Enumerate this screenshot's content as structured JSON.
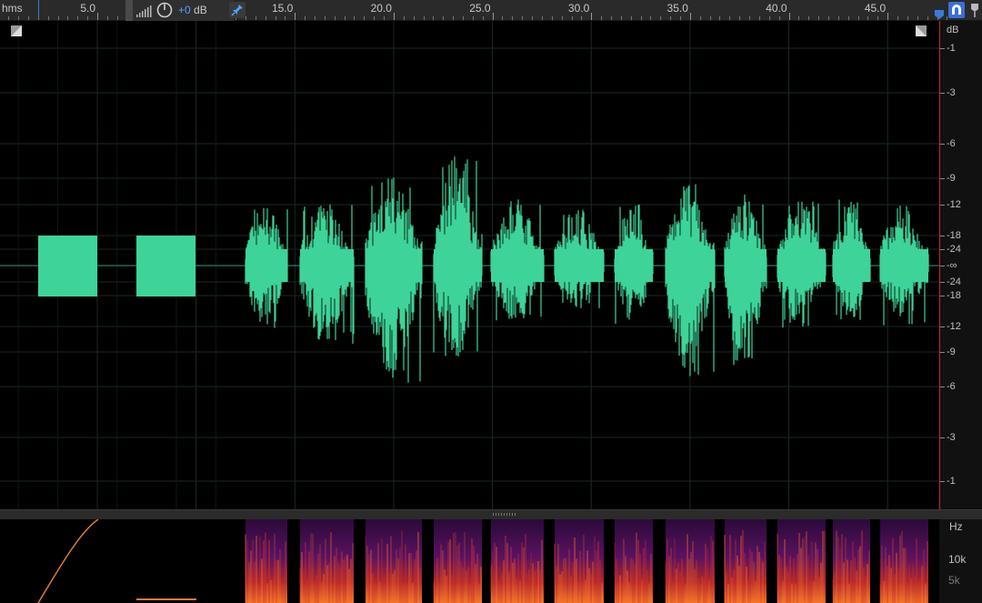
{
  "ruler": {
    "unit": "hms",
    "labels": [
      "5.0",
      "15.0",
      "20.0",
      "25.0",
      "30.0",
      "35.0",
      "40.0",
      "45.0"
    ],
    "label_seconds": [
      5,
      15,
      20,
      25,
      30,
      35,
      40,
      45
    ]
  },
  "hud": {
    "gain_prefix": "+0",
    "gain_unit": "dB"
  },
  "db_scale": {
    "unit": "dB",
    "labels": [
      "-1",
      "-3",
      "-6",
      "-9",
      "-12",
      "-18",
      "-24",
      "-∞",
      "-24",
      "-18",
      "-12",
      "-9",
      "-6",
      "-3",
      "-1"
    ]
  },
  "spectral_scale": {
    "unit": "Hz",
    "labels": [
      "10k",
      "5k"
    ]
  },
  "colors": {
    "waveform": "#3ed398",
    "ruler_bg": "#2a2a2a",
    "accent_blue": "#3a7bd5",
    "clip_red": "#c42a2a"
  },
  "icons": {
    "level_meter": "signal-bars-icon",
    "gain_knob": "knob-icon",
    "pin": "pin-icon",
    "snap": "magnet-icon",
    "marker": "marker-icon"
  }
}
